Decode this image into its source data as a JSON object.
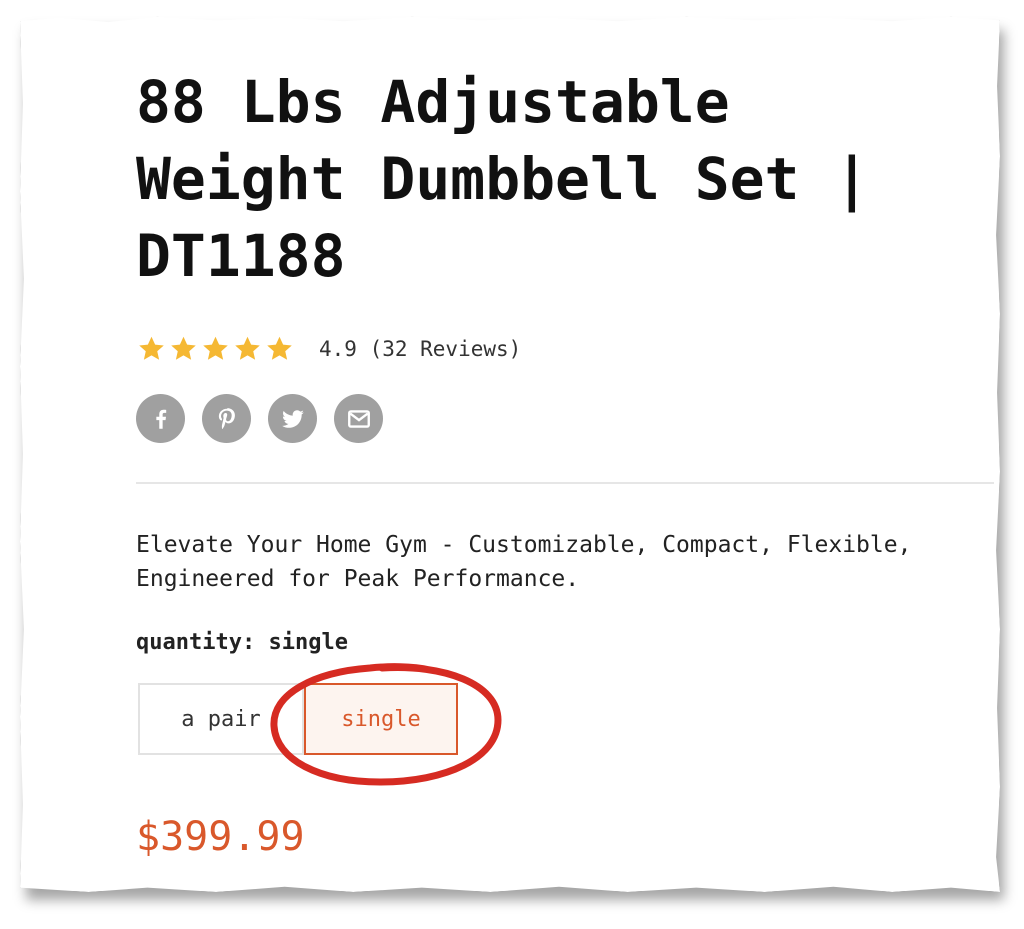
{
  "product": {
    "title": "88 Lbs Adjustable Weight Dumbbell Set | DT1188",
    "rating_text": "4.9 (32 Reviews)",
    "rating_value": 4.9,
    "stars_filled": 5,
    "description": "Elevate Your Home Gym - Customizable, Compact, Flexible, Engineered for Peak Performance.",
    "price": "$399.99"
  },
  "share": {
    "items": [
      {
        "icon": "facebook-icon"
      },
      {
        "icon": "pinterest-icon"
      },
      {
        "icon": "twitter-icon"
      },
      {
        "icon": "email-icon"
      }
    ]
  },
  "quantity": {
    "label": "quantity:",
    "selected": "single",
    "options": [
      "a pair",
      "single"
    ]
  },
  "colors": {
    "accent": "#d9582b",
    "star": "#f5b833",
    "share_icon_bg": "#a0a0a0",
    "annotation": "#d62b22"
  }
}
